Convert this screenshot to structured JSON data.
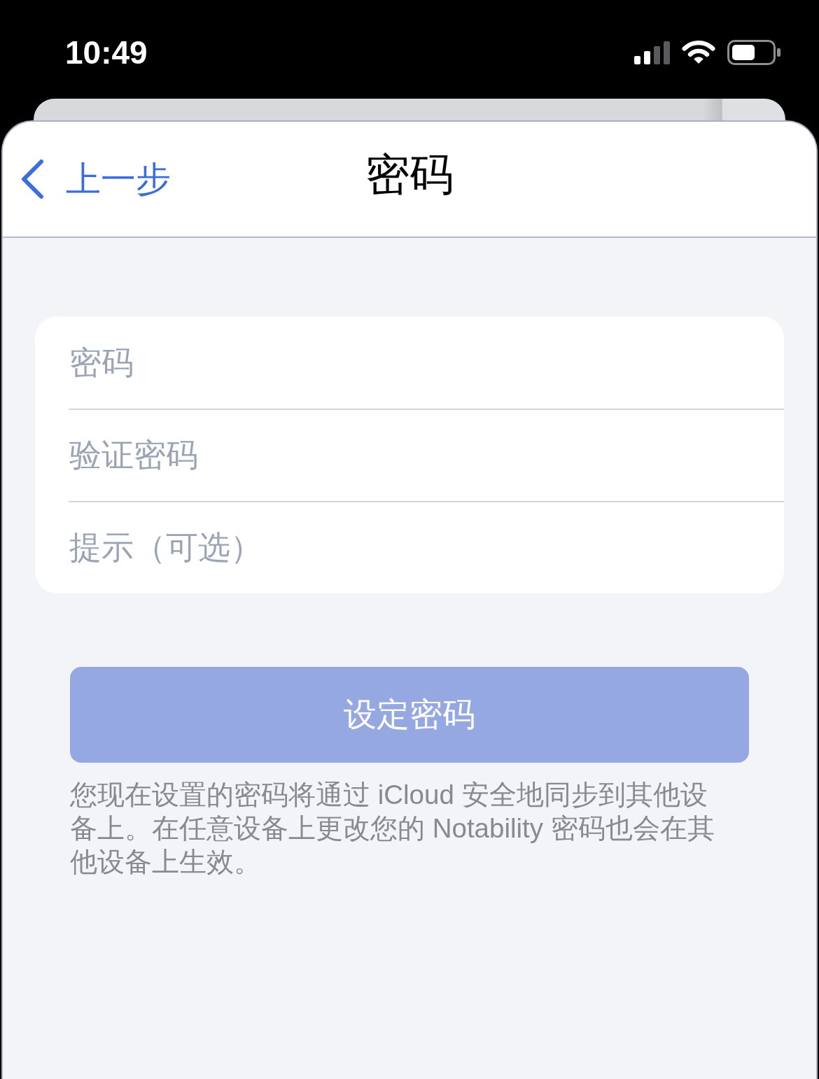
{
  "status_bar": {
    "time": "10:49"
  },
  "nav_bar": {
    "back_label": "上一步",
    "title": "密码"
  },
  "form": {
    "fields": [
      {
        "placeholder": "密码"
      },
      {
        "placeholder": "验证密码"
      },
      {
        "placeholder": "提示（可选）"
      }
    ]
  },
  "primary_button": {
    "label": "设定密码",
    "disabled": true
  },
  "footnote": "您现在设置的密码将通过 iCloud 安全地同步到其他设备上。在任意设备上更改您的 Notability 密码也会在其他设备上生效。"
}
